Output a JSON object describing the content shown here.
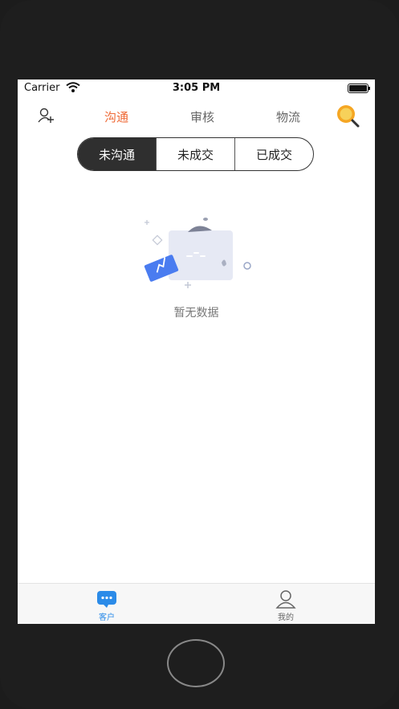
{
  "status": {
    "carrier": "Carrier",
    "time": "3:05 PM"
  },
  "topnav": {
    "tabs": [
      "沟通",
      "审核",
      "物流"
    ],
    "active_tab": "沟通"
  },
  "segments": {
    "items": [
      "未沟通",
      "未成交",
      "已成交"
    ],
    "active": "未沟通"
  },
  "empty_state": {
    "text": "暂无数据"
  },
  "tabbar": {
    "items": [
      {
        "label": "客户",
        "icon": "chat-bubble-icon"
      },
      {
        "label": "我的",
        "icon": "person-icon"
      }
    ],
    "active": "客户"
  },
  "colors": {
    "accent": "#ef6a37",
    "tab_active": "#2b8be8",
    "segment_active_bg": "#2f2f2f",
    "search_ring": "#f5a623"
  }
}
